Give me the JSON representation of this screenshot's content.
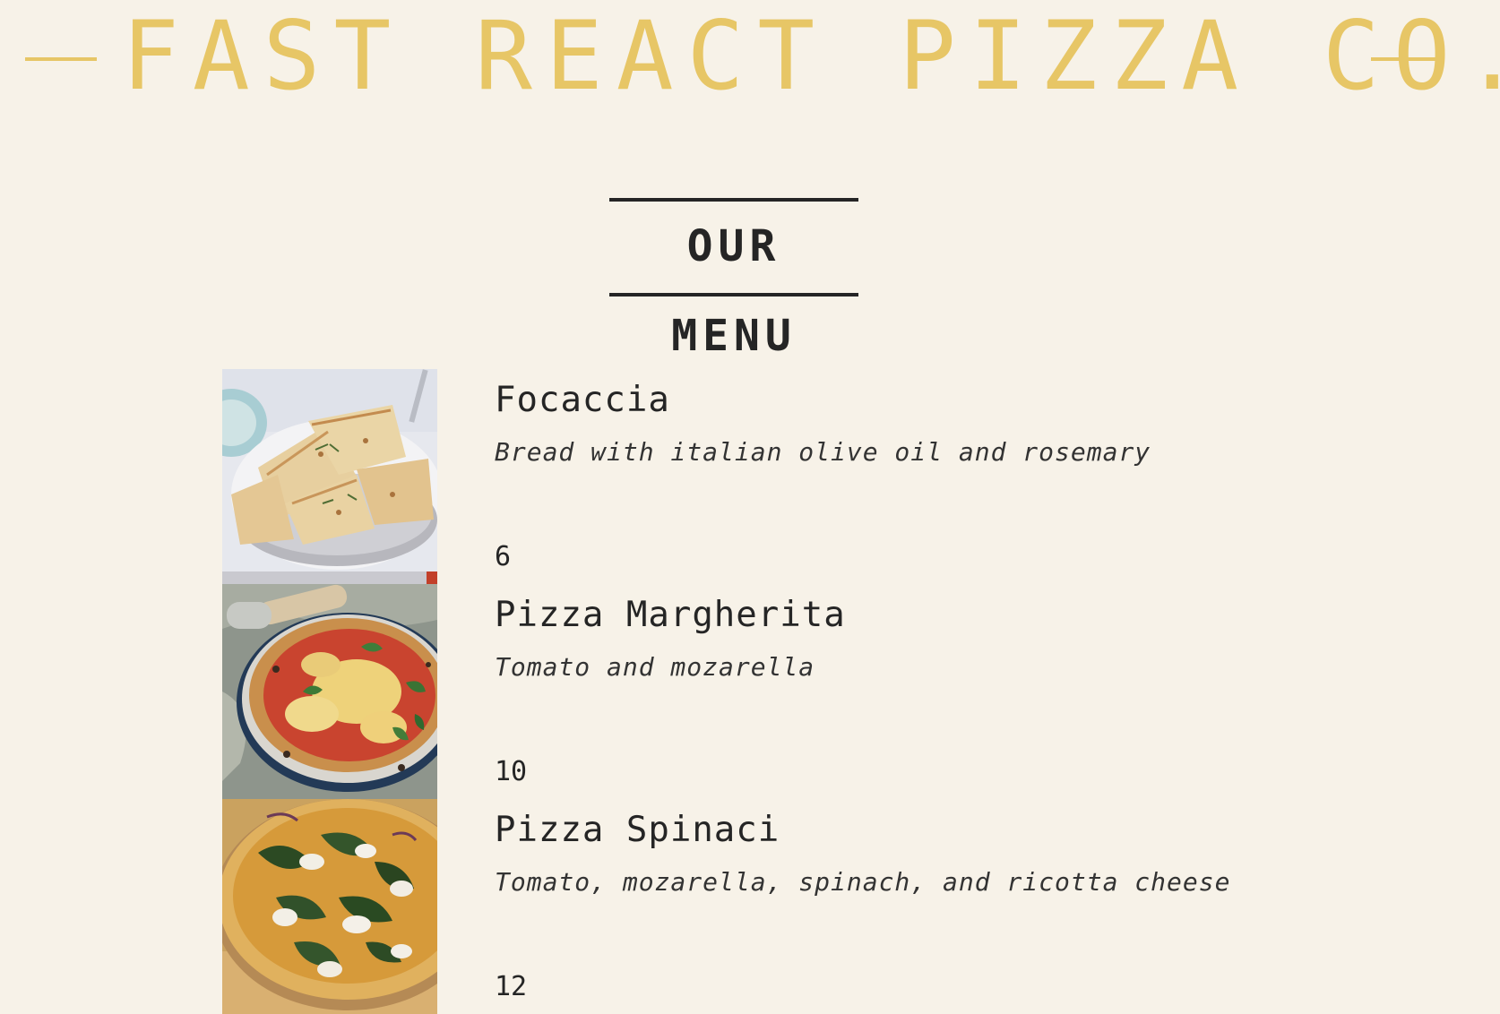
{
  "header": {
    "brand": "FAST REACT PIZZA CO."
  },
  "menu": {
    "title": "OUR MENU",
    "items": [
      {
        "name": "Focaccia",
        "description": "Bread with italian olive oil and rosemary",
        "price": "6",
        "image": "focaccia-photo"
      },
      {
        "name": "Pizza Margherita",
        "description": "Tomato and mozarella",
        "price": "10",
        "image": "pizza-margherita-photo"
      },
      {
        "name": "Pizza Spinaci",
        "description": "Tomato, mozarella, spinach, and ricotta cheese",
        "price": "12",
        "image": "pizza-spinaci-photo"
      }
    ]
  },
  "colors": {
    "background": "#f7f2e8",
    "brand_yellow": "#e7c666",
    "text_dark": "#252525"
  }
}
